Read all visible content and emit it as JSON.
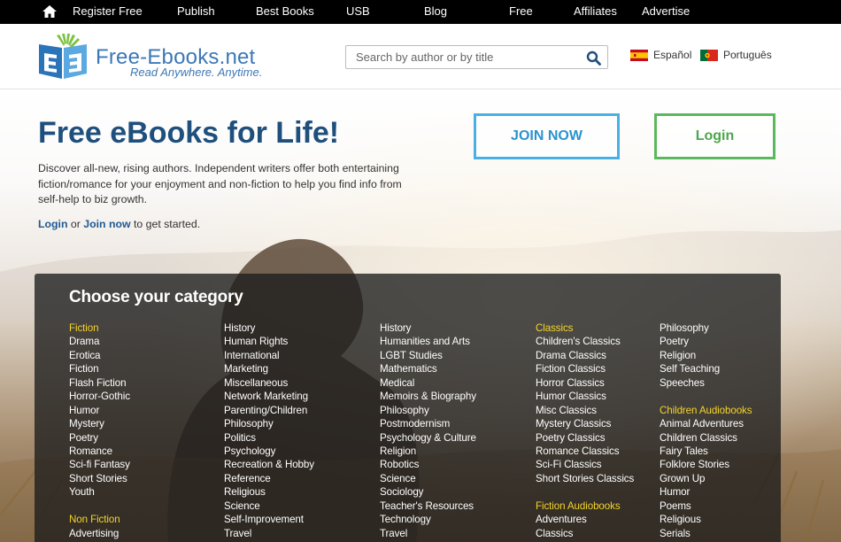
{
  "topnav": {
    "links": [
      "Register Free",
      "Publish",
      "Best Books",
      "USB",
      "Blog",
      "Free",
      "Affiliates",
      "Advertise"
    ]
  },
  "header": {
    "logo_name": "Free-Ebooks.net",
    "logo_tagline": "Read Anywhere. Anytime.",
    "search_placeholder": "Search by author or by title",
    "languages": [
      "Español",
      "Português"
    ]
  },
  "hero": {
    "title": "Free eBooks for Life!",
    "description": "Discover all-new, rising authors. Independent writers offer both entertaining fiction/romance for your enjoyment and non-fiction to help you find info from self-help to biz growth.",
    "cta_login": "Login",
    "cta_or": " or ",
    "cta_join": "Join now",
    "cta_suffix": " to get started.",
    "join_button": "JOIN NOW",
    "login_button": "Login"
  },
  "categories": {
    "title": "Choose your category",
    "colors": {
      "heading": "#f5d42a",
      "item": "#ffffff"
    },
    "columns": [
      [
        {
          "label": "Fiction",
          "head": true
        },
        {
          "label": "Drama"
        },
        {
          "label": "Erotica"
        },
        {
          "label": "Fiction"
        },
        {
          "label": "Flash Fiction"
        },
        {
          "label": "Horror-Gothic"
        },
        {
          "label": "Humor"
        },
        {
          "label": "Mystery"
        },
        {
          "label": "Poetry"
        },
        {
          "label": "Romance"
        },
        {
          "label": "Sci-fi Fantasy"
        },
        {
          "label": "Short Stories"
        },
        {
          "label": "Youth"
        },
        {
          "gap": true
        },
        {
          "label": "Non Fiction",
          "head": true
        },
        {
          "label": "Advertising"
        }
      ],
      [
        {
          "label": "History"
        },
        {
          "label": "Human Rights"
        },
        {
          "label": "International"
        },
        {
          "label": "Marketing"
        },
        {
          "label": "Miscellaneous"
        },
        {
          "label": "Network Marketing"
        },
        {
          "label": "Parenting/Children"
        },
        {
          "label": "Philosophy"
        },
        {
          "label": "Politics"
        },
        {
          "label": "Psychology"
        },
        {
          "label": "Recreation & Hobby"
        },
        {
          "label": "Reference"
        },
        {
          "label": "Religious"
        },
        {
          "label": "Science"
        },
        {
          "label": "Self-Improvement"
        },
        {
          "label": "Travel"
        }
      ],
      [
        {
          "label": "History"
        },
        {
          "label": "Humanities and Arts"
        },
        {
          "label": "LGBT Studies"
        },
        {
          "label": "Mathematics"
        },
        {
          "label": "Medical"
        },
        {
          "label": "Memoirs & Biography"
        },
        {
          "label": "Philosophy"
        },
        {
          "label": "Postmodernism"
        },
        {
          "label": "Psychology & Culture"
        },
        {
          "label": "Religion"
        },
        {
          "label": "Robotics"
        },
        {
          "label": "Science"
        },
        {
          "label": "Sociology"
        },
        {
          "label": "Teacher's Resources"
        },
        {
          "label": "Technology"
        },
        {
          "label": "Travel"
        }
      ],
      [
        {
          "label": "Classics",
          "head": true
        },
        {
          "label": "Children's Classics"
        },
        {
          "label": "Drama Classics"
        },
        {
          "label": "Fiction Classics"
        },
        {
          "label": "Horror Classics"
        },
        {
          "label": "Humor Classics"
        },
        {
          "label": "Misc Classics"
        },
        {
          "label": "Mystery Classics"
        },
        {
          "label": "Poetry Classics"
        },
        {
          "label": "Romance Classics"
        },
        {
          "label": "Sci-Fi Classics"
        },
        {
          "label": "Short Stories Classics"
        },
        {
          "gap": true
        },
        {
          "label": "Fiction Audiobooks",
          "head": true
        },
        {
          "label": "Adventures"
        },
        {
          "label": "Classics"
        }
      ],
      [
        {
          "label": "Philosophy"
        },
        {
          "label": "Poetry"
        },
        {
          "label": "Religion"
        },
        {
          "label": "Self Teaching"
        },
        {
          "label": "Speeches"
        },
        {
          "gap": true
        },
        {
          "label": "Children Audiobooks",
          "head": true
        },
        {
          "label": "Animal Adventures"
        },
        {
          "label": "Children Classics"
        },
        {
          "label": "Fairy Tales"
        },
        {
          "label": "Folklore Stories"
        },
        {
          "label": "Grown Up"
        },
        {
          "label": "Humor"
        },
        {
          "label": "Poems"
        },
        {
          "label": "Religious"
        },
        {
          "label": "Serials"
        }
      ]
    ]
  }
}
